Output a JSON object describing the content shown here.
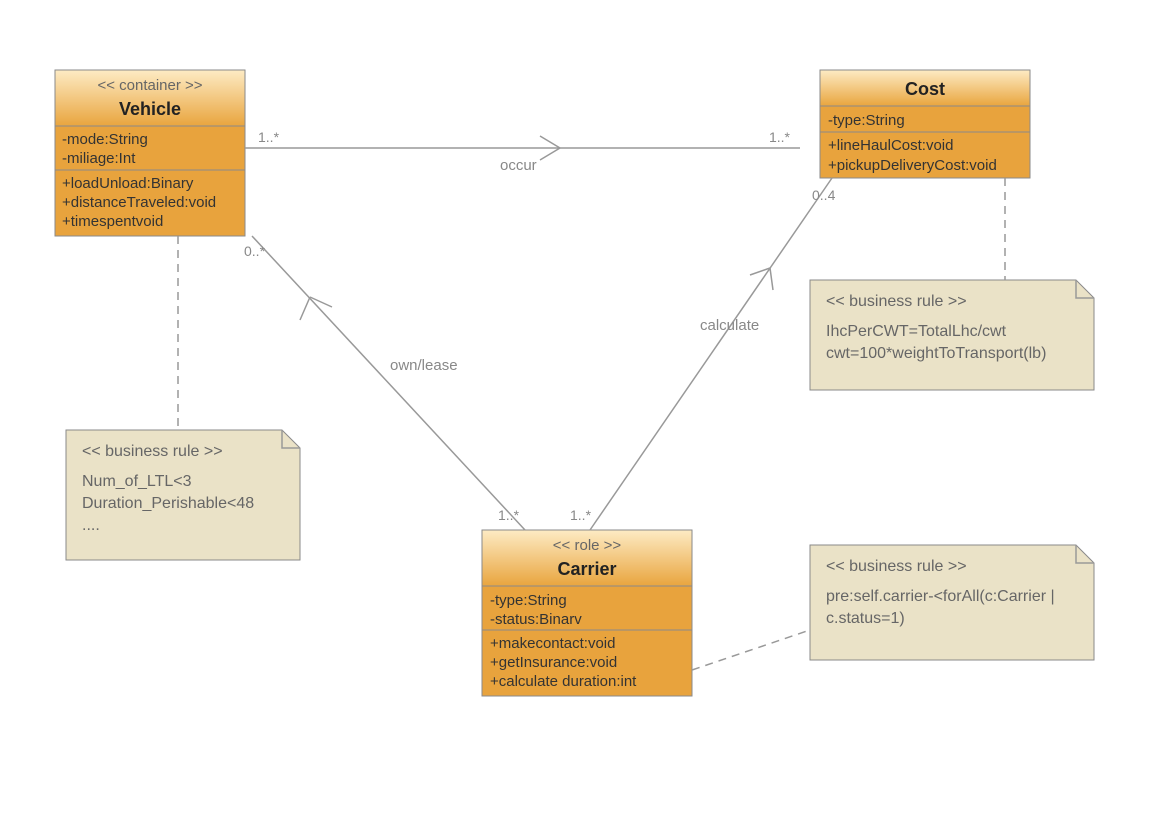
{
  "classes": {
    "vehicle": {
      "stereotype": "<< container >>",
      "name": "Vehicle",
      "attrs": [
        "-mode:String",
        "-miliage:Int"
      ],
      "ops": [
        "+loadUnload:Binary",
        "+distanceTraveled:void",
        "+timespentvoid"
      ]
    },
    "cost": {
      "name": "Cost",
      "attrs": [
        "-type:String"
      ],
      "ops": [
        "+lineHaulCost:void",
        "+pickupDeliveryCost:void"
      ]
    },
    "carrier": {
      "stereotype": "<< role >>",
      "name": "Carrier",
      "attrs": [
        "-type:String",
        "-status:Binarv"
      ],
      "ops": [
        "+makecontact:void",
        "+getInsurance:void",
        "+calculate duration:int"
      ]
    }
  },
  "notes": {
    "vehicleRule": {
      "stereotype": "<< business rule >>",
      "lines": [
        "Num_of_LTL<3",
        "Duration_Perishable<48",
        "...."
      ]
    },
    "costRule": {
      "stereotype": "<< business rule >>",
      "lines": [
        "IhcPerCWT=TotalLhc/cwt",
        "cwt=100*weightToTransport(lb)"
      ]
    },
    "carrierRule": {
      "stereotype": "<< business rule >>",
      "lines": [
        "pre:self.carrier-<forAll(c:Carrier |",
        "c.status=1)"
      ]
    }
  },
  "associations": {
    "occur": {
      "label": "occur",
      "mult_from": "1..*",
      "mult_to": "1..*"
    },
    "ownLease": {
      "label": "own/lease",
      "mult_from": "1..*",
      "mult_to": "0..*"
    },
    "calculate": {
      "label": "calculate",
      "mult_from": "1..*",
      "mult_to": "0..4"
    }
  }
}
